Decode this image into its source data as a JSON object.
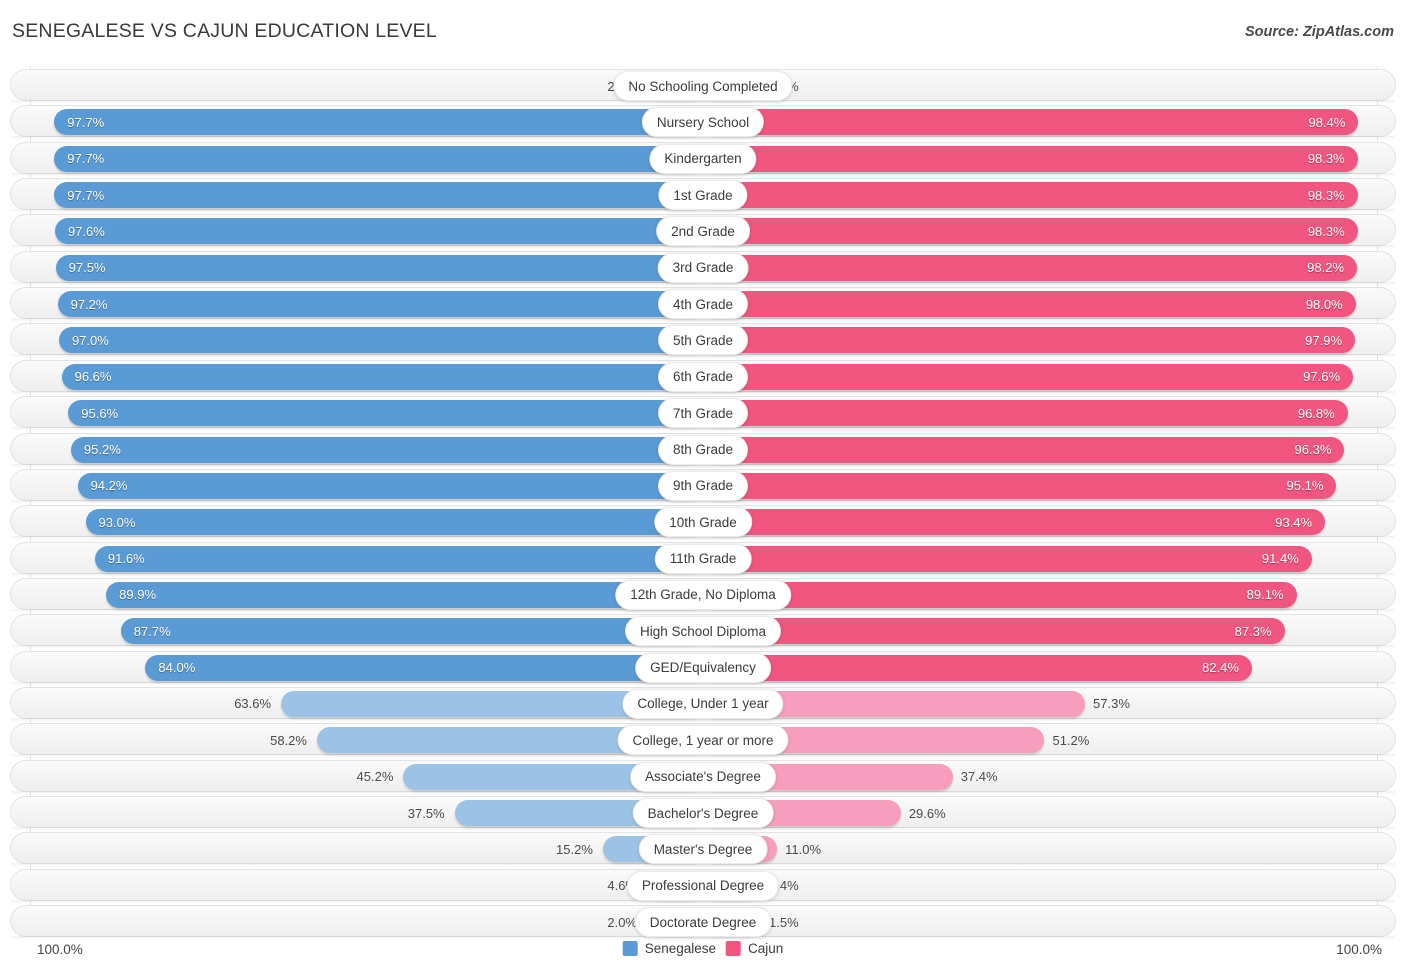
{
  "header": {
    "title": "SENEGALESE VS CAJUN EDUCATION LEVEL",
    "source": "Source: ZipAtlas.com"
  },
  "footer": {
    "axis_left": "100.0%",
    "axis_right": "100.0%",
    "legend": [
      {
        "label": "Senegalese",
        "color": "#5B9BD5"
      },
      {
        "label": "Cajun",
        "color": "#F0567F"
      }
    ]
  },
  "colors": {
    "senegalese_strong": "#5B9BD5",
    "senegalese_light": "#9CC3E6",
    "cajun_strong": "#F0567F",
    "cajun_light": "#F79EBF"
  },
  "chart_data": {
    "type": "bar",
    "title": "SENEGALESE VS CAJUN EDUCATION LEVEL",
    "subtitle": "Source: ZipAtlas.com",
    "orientation": "horizontal-diverging",
    "xlabel": "",
    "ylabel": "",
    "xlim": [
      0,
      100
    ],
    "grid": false,
    "legend_position": "bottom-center",
    "axis_tick_labels": [
      "100.0%",
      "100.0%"
    ],
    "categories": [
      "No Schooling Completed",
      "Nursery School",
      "Kindergarten",
      "1st Grade",
      "2nd Grade",
      "3rd Grade",
      "4th Grade",
      "5th Grade",
      "6th Grade",
      "7th Grade",
      "8th Grade",
      "9th Grade",
      "10th Grade",
      "11th Grade",
      "12th Grade, No Diploma",
      "High School Diploma",
      "GED/Equivalency",
      "College, Under 1 year",
      "College, 1 year or more",
      "Associate's Degree",
      "Bachelor's Degree",
      "Master's Degree",
      "Professional Degree",
      "Doctorate Degree"
    ],
    "series": [
      {
        "name": "Senegalese",
        "color": "#5B9BD5",
        "values": [
          2.3,
          97.7,
          97.7,
          97.7,
          97.6,
          97.5,
          97.2,
          97.0,
          96.6,
          95.6,
          95.2,
          94.2,
          93.0,
          91.6,
          89.9,
          87.7,
          84.0,
          63.6,
          58.2,
          45.2,
          37.5,
          15.2,
          4.6,
          2.0
        ],
        "labels": [
          "2.3%",
          "97.7%",
          "97.7%",
          "97.7%",
          "97.6%",
          "97.5%",
          "97.2%",
          "97.0%",
          "96.6%",
          "95.6%",
          "95.2%",
          "94.2%",
          "93.0%",
          "91.6%",
          "89.9%",
          "87.7%",
          "84.0%",
          "63.6%",
          "58.2%",
          "45.2%",
          "37.5%",
          "15.2%",
          "4.6%",
          "2.0%"
        ]
      },
      {
        "name": "Cajun",
        "color": "#F0567F",
        "values": [
          1.7,
          98.4,
          98.3,
          98.3,
          98.3,
          98.2,
          98.0,
          97.9,
          97.6,
          96.8,
          96.3,
          95.1,
          93.4,
          91.4,
          89.1,
          87.3,
          82.4,
          57.3,
          51.2,
          37.4,
          29.6,
          11.0,
          3.4,
          1.5
        ],
        "labels": [
          "1.7%",
          "98.4%",
          "98.3%",
          "98.3%",
          "98.3%",
          "98.2%",
          "98.0%",
          "97.9%",
          "97.6%",
          "96.8%",
          "96.3%",
          "95.1%",
          "93.4%",
          "91.4%",
          "89.1%",
          "87.3%",
          "82.4%",
          "57.3%",
          "51.2%",
          "37.4%",
          "29.6%",
          "11.0%",
          "3.4%",
          "1.5%"
        ]
      }
    ]
  }
}
